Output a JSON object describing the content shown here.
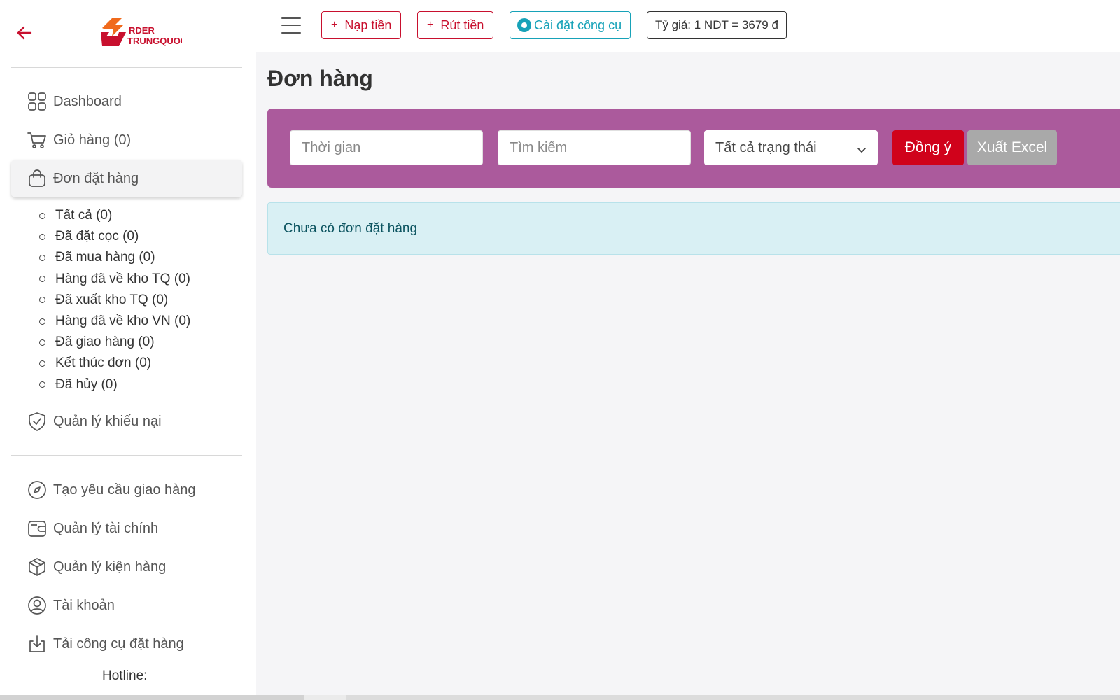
{
  "app": {
    "logo_text_top": "RDER",
    "logo_text_bottom": "TRUNGQUOC",
    "logo_colors": {
      "orange": "#f06a1c",
      "red": "#c8102e"
    }
  },
  "topbar": {
    "deposit_label": "Nạp tiền",
    "withdraw_label": "Rút tiền",
    "install_tool_label": "Cài đặt công cụ",
    "exchange_rate": "Tỷ giá: 1 NDT = 3679 đ"
  },
  "sidebar": {
    "items_top": [
      {
        "label": "Dashboard",
        "icon": "grid-icon"
      },
      {
        "label": "Giỏ hàng (0)",
        "icon": "cart-icon"
      },
      {
        "label": "Đơn đặt hàng",
        "icon": "shopping-bag-icon",
        "active": true
      }
    ],
    "order_subitems": [
      "Tất cả (0)",
      "Đã đặt cọc (0)",
      "Đã mua hàng (0)",
      "Hàng đã về kho TQ (0)",
      "Đã xuất kho TQ (0)",
      "Hàng đã về kho VN (0)",
      "Đã giao hàng (0)",
      "Kết thúc đơn (0)",
      "Đã hủy (0)"
    ],
    "complaints_label": "Quản lý khiếu nại",
    "items_bottom": [
      {
        "label": "Tạo yêu cầu giao hàng",
        "icon": "compass-icon"
      },
      {
        "label": "Quản lý tài chính",
        "icon": "wallet-icon"
      },
      {
        "label": "Quản lý kiện hàng",
        "icon": "package-icon"
      },
      {
        "label": "Tài khoản",
        "icon": "user-circle-icon"
      },
      {
        "label": "Tải công cụ đặt hàng",
        "icon": "download-icon"
      }
    ],
    "hotline_label": "Hotline:"
  },
  "main": {
    "title": "Đơn hàng",
    "filters": {
      "time_placeholder": "Thời gian",
      "search_placeholder": "Tìm kiếm",
      "status_selected": "Tất cả trạng thái",
      "apply_label": "Đồng ý",
      "export_label": "Xuất Excel"
    },
    "empty_message": "Chưa có đơn đặt hàng"
  },
  "colors": {
    "accent_red": "#c8102e",
    "filter_bar": "#ab5a9c",
    "apply_button": "#d0021b",
    "export_button": "#a9a9a9",
    "info_bg": "#d9f0f4",
    "cyan": "#17a2b8"
  }
}
